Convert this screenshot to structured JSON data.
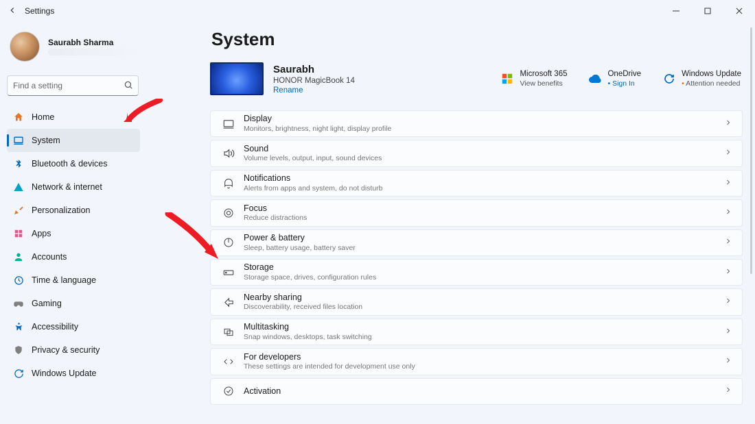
{
  "window": {
    "title": "Settings"
  },
  "user": {
    "name": "Saurabh Sharma"
  },
  "search": {
    "placeholder": "Find a setting"
  },
  "nav": [
    {
      "id": "home",
      "label": "Home"
    },
    {
      "id": "system",
      "label": "System",
      "selected": true
    },
    {
      "id": "bluetooth",
      "label": "Bluetooth & devices"
    },
    {
      "id": "network",
      "label": "Network & internet"
    },
    {
      "id": "personal",
      "label": "Personalization"
    },
    {
      "id": "apps",
      "label": "Apps"
    },
    {
      "id": "accounts",
      "label": "Accounts"
    },
    {
      "id": "time",
      "label": "Time & language"
    },
    {
      "id": "gaming",
      "label": "Gaming"
    },
    {
      "id": "access",
      "label": "Accessibility"
    },
    {
      "id": "privacy",
      "label": "Privacy & security"
    },
    {
      "id": "update",
      "label": "Windows Update"
    }
  ],
  "page": {
    "title": "System",
    "device": {
      "name": "Saurabh",
      "model": "HONOR MagicBook 14",
      "rename": "Rename"
    },
    "pills": [
      {
        "id": "m365",
        "title": "Microsoft 365",
        "sub": "View benefits"
      },
      {
        "id": "onedrive",
        "title": "OneDrive",
        "sub": "Sign In",
        "dot": "info"
      },
      {
        "id": "wupdate",
        "title": "Windows Update",
        "sub": "Attention needed",
        "dot": "warn"
      }
    ],
    "cards": [
      {
        "id": "display",
        "title": "Display",
        "sub": "Monitors, brightness, night light, display profile"
      },
      {
        "id": "sound",
        "title": "Sound",
        "sub": "Volume levels, output, input, sound devices"
      },
      {
        "id": "notify",
        "title": "Notifications",
        "sub": "Alerts from apps and system, do not disturb"
      },
      {
        "id": "focus",
        "title": "Focus",
        "sub": "Reduce distractions"
      },
      {
        "id": "power",
        "title": "Power & battery",
        "sub": "Sleep, battery usage, battery saver"
      },
      {
        "id": "storage",
        "title": "Storage",
        "sub": "Storage space, drives, configuration rules"
      },
      {
        "id": "nearby",
        "title": "Nearby sharing",
        "sub": "Discoverability, received files location"
      },
      {
        "id": "multitask",
        "title": "Multitasking",
        "sub": "Snap windows, desktops, task switching"
      },
      {
        "id": "devs",
        "title": "For developers",
        "sub": "These settings are intended for development use only"
      },
      {
        "id": "activation",
        "title": "Activation",
        "sub": ""
      }
    ]
  }
}
